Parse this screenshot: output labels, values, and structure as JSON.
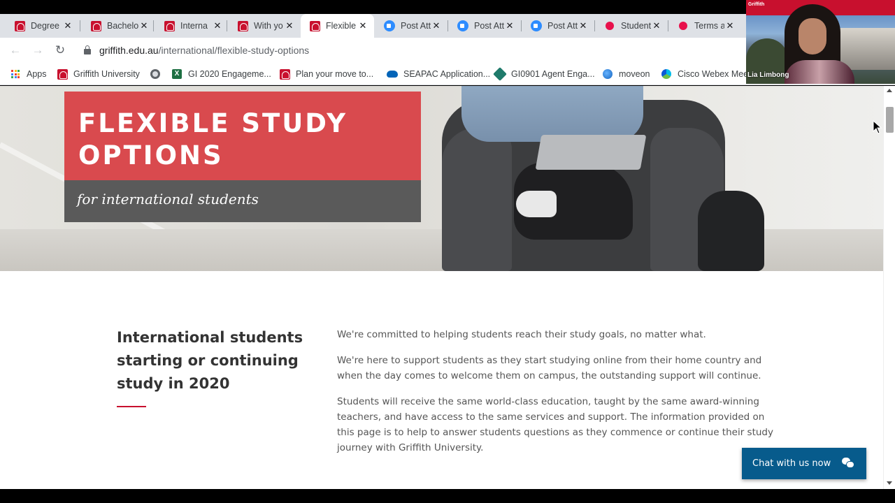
{
  "browser": {
    "tabs": [
      {
        "title": "Degree",
        "icon": "griffith-icon",
        "active": false
      },
      {
        "title": "Bachelo",
        "icon": "griffith-icon",
        "active": false
      },
      {
        "title": "Interna",
        "icon": "griffith-icon",
        "active": false
      },
      {
        "title": "With yo",
        "icon": "griffith-icon",
        "active": false
      },
      {
        "title": "Flexible",
        "icon": "griffith-icon",
        "active": true
      },
      {
        "title": "Post Att",
        "icon": "zoom-icon",
        "active": false
      },
      {
        "title": "Post Att",
        "icon": "zoom-icon",
        "active": false
      },
      {
        "title": "Post Att",
        "icon": "zoom-icon",
        "active": false
      },
      {
        "title": "Student",
        "icon": "red-dot-icon",
        "active": false
      },
      {
        "title": "Terms a",
        "icon": "red-dot-icon",
        "active": false
      }
    ],
    "tab_close_glyph": "✕",
    "address": {
      "domain": "griffith.edu.au",
      "path": "/international/flexible-study-options"
    },
    "nav": {
      "back": "←",
      "forward": "→",
      "reload": "↻"
    },
    "bookmarks": [
      {
        "label": "Apps",
        "icon": "apps-grid-icon"
      },
      {
        "label": "Griffith University",
        "icon": "griffith-icon"
      },
      {
        "label": "",
        "icon": "globe-icon"
      },
      {
        "label": "GI 2020 Engageme...",
        "icon": "excel-icon"
      },
      {
        "label": "Plan your move to...",
        "icon": "griffith-icon"
      },
      {
        "label": "SEAPAC Application...",
        "icon": "onedrive-icon"
      },
      {
        "label": "GI0901 Agent Enga...",
        "icon": "agent-icon"
      },
      {
        "label": "moveon",
        "icon": "moveon-icon"
      },
      {
        "label": "Cisco Webex Meet",
        "icon": "webex-icon"
      }
    ],
    "excel_glyph": "X"
  },
  "page": {
    "hero": {
      "title_line1": "FLEXIBLE STUDY",
      "title_line2": "OPTIONS",
      "subtitle": "for international students"
    },
    "section": {
      "heading": "International students starting or continuing study in 2020",
      "paragraphs": [
        "We're committed to helping students reach their study goals, no matter what.",
        "We're here to support students as they start studying online from their home country and when the day comes to welcome them on campus, the outstanding support will continue.",
        "Students will receive the same world-class education, taught by the same award-winning teachers, and have access to the same services and support. The information provided on this page is to help to answer students questions as they commence or continue their study journey with Griffith University."
      ]
    },
    "chat_button": "Chat with us now"
  },
  "webcam": {
    "participant_name": "Lia Limbong",
    "logo_text": "Griffith"
  },
  "colors": {
    "brand_red": "#d94a4e",
    "hero_grey": "#5a5a5a",
    "chat_blue": "#075b8c",
    "rule_red": "#c8102e"
  }
}
